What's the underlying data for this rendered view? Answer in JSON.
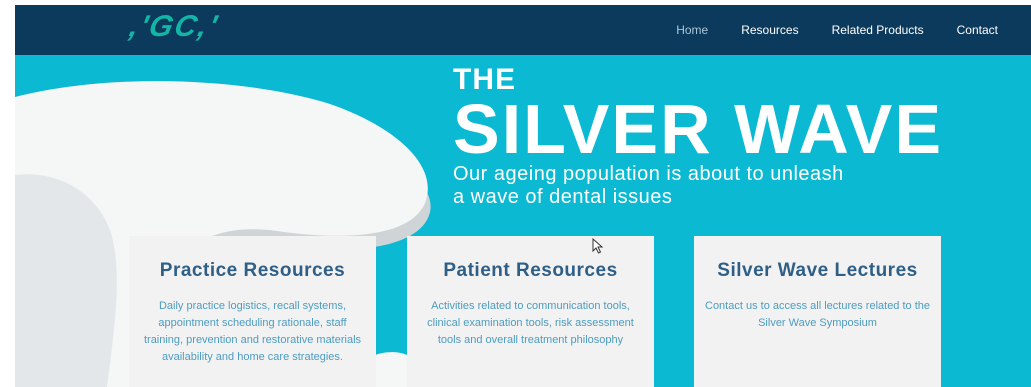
{
  "header": {
    "logo_text": ",'GC,'",
    "nav": [
      {
        "label": "Home",
        "active": true
      },
      {
        "label": "Resources",
        "active": false
      },
      {
        "label": "Related Products",
        "active": false
      },
      {
        "label": "Contact",
        "active": false
      }
    ]
  },
  "hero": {
    "line1": "THE",
    "line2": "SILVER WAVE",
    "subtitle_line1": "Our ageing population is about to unleash",
    "subtitle_line2": "a wave of dental issues"
  },
  "cards": [
    {
      "title": "Practice Resources",
      "text": "Daily practice logistics, recall systems, appointment scheduling rationale, staff training, prevention and restorative materials availability and home care strategies."
    },
    {
      "title": "Patient Resources",
      "text": "Activities related to communication tools, clinical examination tools, risk assessment tools and overall treatment philosophy"
    },
    {
      "title": "Silver Wave Lectures",
      "text": "Contact us to access all lectures related to the Silver Wave Symposium"
    }
  ],
  "colors": {
    "navbar": "#0c3a5c",
    "logo": "#13b5a7",
    "hero": "#0cb9d3",
    "card_title": "#2f5f87",
    "card_text": "#4d9cc0"
  }
}
